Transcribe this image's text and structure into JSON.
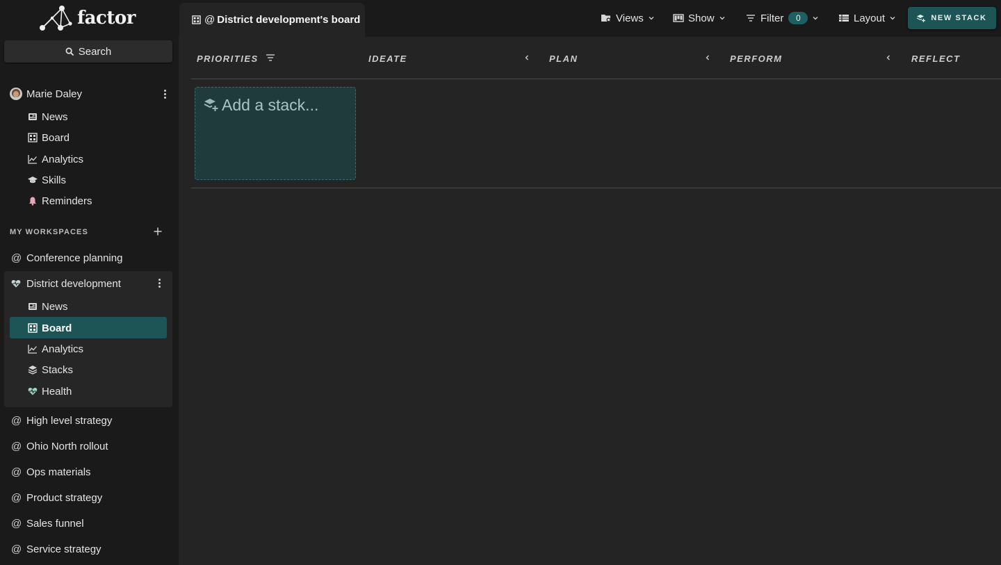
{
  "app": {
    "logo_text": "factor"
  },
  "sidebar": {
    "search_label": "Search",
    "user": {
      "name": "Marie Daley",
      "items": [
        {
          "label": "News",
          "icon": "newspaper-icon"
        },
        {
          "label": "Board",
          "icon": "grid-icon"
        },
        {
          "label": "Analytics",
          "icon": "chart-line-icon"
        },
        {
          "label": "Skills",
          "icon": "graduation-cap-icon"
        },
        {
          "label": "Reminders",
          "icon": "bell-icon"
        }
      ]
    },
    "workspaces_label": "MY WORKSPACES",
    "workspaces": [
      {
        "label": "Conference planning"
      },
      {
        "label": "District development",
        "expanded": true,
        "items": [
          {
            "label": "News",
            "icon": "newspaper-icon"
          },
          {
            "label": "Board",
            "icon": "grid-icon",
            "selected": true
          },
          {
            "label": "Analytics",
            "icon": "chart-line-icon"
          },
          {
            "label": "Stacks",
            "icon": "layers-icon"
          },
          {
            "label": "Health",
            "icon": "heart-pulse-icon"
          }
        ]
      },
      {
        "label": "High level strategy"
      },
      {
        "label": "Ohio North rollout"
      },
      {
        "label": "Ops materials"
      },
      {
        "label": "Product strategy"
      },
      {
        "label": "Sales funnel"
      },
      {
        "label": "Service strategy"
      }
    ]
  },
  "header": {
    "tab_title": "District development's board",
    "views_label": "Views",
    "show_label": "Show",
    "filter_label": "Filter",
    "filter_count": "0",
    "layout_label": "Layout",
    "new_stack_label": "NEW STACK"
  },
  "board": {
    "columns": [
      "PRIORITIES",
      "IDEATE",
      "PLAN",
      "PERFORM",
      "REFLECT"
    ],
    "add_stack_label": "Add a stack..."
  },
  "colors": {
    "accent": "#1d5556",
    "sidebar_bg": "#1a1a1a",
    "board_bg": "#242424"
  }
}
